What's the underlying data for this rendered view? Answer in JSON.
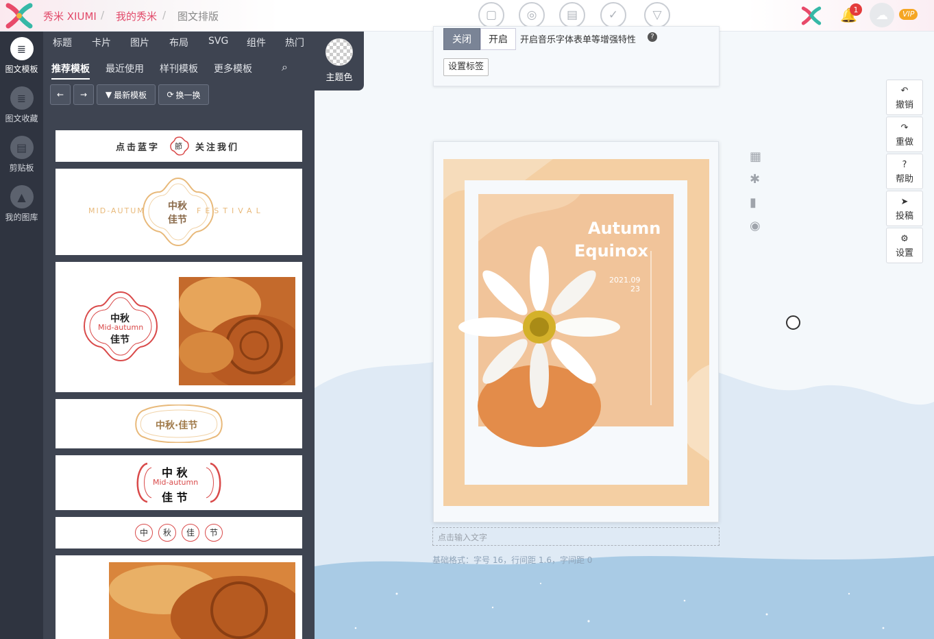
{
  "header": {
    "brand": "秀米 XIUMI",
    "crumbs": [
      "我的秀米",
      "图文排版"
    ],
    "toolbar_icons": [
      "folder-icon",
      "preview-icon",
      "print-icon",
      "check-icon",
      "dropdown-icon"
    ],
    "notification_count": "1",
    "vip_label": "VIP"
  },
  "leftnav": {
    "items": [
      {
        "label": "图文模板",
        "icon": "template-icon"
      },
      {
        "label": "图文收藏",
        "icon": "favorites-icon"
      },
      {
        "label": "剪贴板",
        "icon": "clipboard-icon"
      },
      {
        "label": "我的图库",
        "icon": "gallery-icon"
      }
    ]
  },
  "panel": {
    "categories": [
      "标题",
      "卡片",
      "图片",
      "布局",
      "SVG",
      "组件",
      "热门"
    ],
    "subtabs": [
      "推荐模板",
      "最近使用",
      "样刊模板",
      "更多模板"
    ],
    "theme_label": "主题色",
    "buttons": {
      "newest": "最新模板",
      "shuffle": "换一换"
    },
    "templates": {
      "follow": {
        "left": "点击蓝字",
        "center": "節",
        "right": "关注我们"
      },
      "festival": {
        "left": "MID-AUTUMN",
        "line1": "中秋",
        "line2": "佳节",
        "right": "FESTIVAL"
      },
      "mooncake_badge": {
        "line1": "中秋",
        "mid": "Mid-autumn",
        "line2": "佳节"
      },
      "oval": {
        "text": "中秋·佳节"
      },
      "bracket": {
        "line1": "中 秋",
        "mid": "Mid-autumn",
        "line2": "佳 节"
      },
      "chars": [
        "中",
        "秋",
        "佳",
        "节"
      ]
    }
  },
  "editor": {
    "toggle_off": "关闭",
    "toggle_on": "开启",
    "toggle_desc": "开启音乐字体表单等增强特性",
    "set_tag": "设置标签",
    "poster_title_1": "Autumn",
    "poster_title_2": "Equinox",
    "poster_date_1": "2021.09",
    "poster_date_2": "23",
    "text_placeholder": "点击输入文字",
    "format_info": "基础格式：字号 16，行间距 1.6，字间距 0"
  },
  "right_tools": [
    {
      "label": "撤销",
      "icon": "undo-icon"
    },
    {
      "label": "重做",
      "icon": "redo-icon"
    },
    {
      "label": "帮助",
      "icon": "help-icon"
    },
    {
      "label": "投稿",
      "icon": "send-icon"
    },
    {
      "label": "设置",
      "icon": "gear-icon"
    }
  ],
  "colors": {
    "accent_red": "#d94a4a",
    "festival_gold": "#e8b97a",
    "panel_bg": "#3e4451",
    "nav_bg": "#2f3440",
    "poster_peach": "#f4c99a"
  }
}
